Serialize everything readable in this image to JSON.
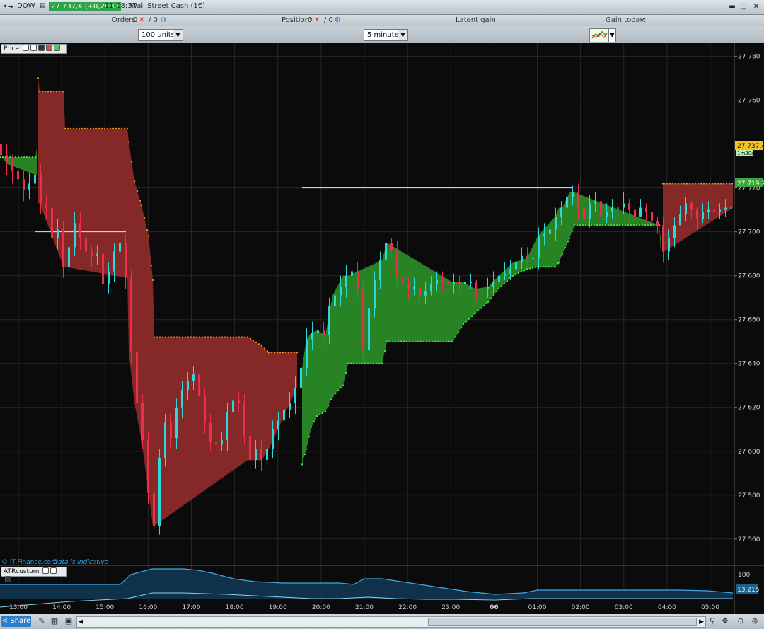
{
  "titlebar": {
    "symbol": "DOW",
    "quote": "27 737,4 (+0,20%)",
    "time": "11:08:37",
    "instrument": "Wall Street Cash (1€)"
  },
  "infobar": {
    "orders_label": "Orders:",
    "orders_value": "0",
    "orders_sep": "/ 0",
    "position_label": "Position:",
    "position_value": "0",
    "position_sep": "/ 0",
    "latent_label": "Latent gain:",
    "latent_value": "-",
    "gain_today_label": "Gain today:",
    "gain_today_value": "-"
  },
  "controls": {
    "units": "100 units",
    "timeframe": "5 minutes"
  },
  "panels": {
    "price_label": "Price",
    "indicator_label": "ATRcustom",
    "watermark": "© IT-Finance.com",
    "watermark_note": "Data is indicative"
  },
  "bottombar": {
    "share": "Share"
  },
  "colors": {
    "bull": "#2fd8d8",
    "bear": "#ea2f4e",
    "fill_up": "#2a8a26",
    "fill_down": "#8c2a2a",
    "stop_up": "#39e83a",
    "stop_down": "#f08a1a",
    "last_price_bg": "#f6c420",
    "trend_price_bg": "#3ba63a"
  },
  "chart_data": {
    "type": "candlestick",
    "price_axis": {
      "ylim": [
        27548,
        27786
      ],
      "ticks": [
        "27 780",
        "27 760",
        "27 740",
        "27 720",
        "27 700",
        "27 680",
        "27 660",
        "27 640",
        "27 620",
        "27 600",
        "27 580",
        "27 560"
      ],
      "tick_values": [
        27780,
        27760,
        27740,
        27720,
        27700,
        27680,
        27660,
        27640,
        27620,
        27600,
        27580,
        27560
      ]
    },
    "time_axis": {
      "labels": [
        "13:00",
        "14:00",
        "15:00",
        "16:00",
        "17:00",
        "18:00",
        "19:00",
        "20:00",
        "21:00",
        "22:00",
        "23:00",
        "06",
        "01:00",
        "02:00",
        "03:00",
        "04:00",
        "05:00"
      ],
      "bold_index": 11
    },
    "last_price": "27 737,4",
    "countdown": "1m20s",
    "trend_level": "27 719,7",
    "indicator_value": "13,215",
    "indicator_axis": {
      "ticks": [
        "100"
      ],
      "tick_values": [
        100
      ]
    },
    "trend_segments": [
      {
        "dir": "up",
        "points": [
          [
            0,
            27734
          ],
          [
            10,
            27734
          ],
          [
            50,
            27734
          ],
          [
            52,
            27738
          ]
        ]
      },
      {
        "dir": "down",
        "points": [
          [
            54,
            27770
          ],
          [
            56,
            27764
          ],
          [
            90,
            27764
          ],
          [
            92,
            27747
          ],
          [
            180,
            27747
          ],
          [
            182,
            27741
          ],
          [
            190,
            27723
          ],
          [
            200,
            27712
          ],
          [
            210,
            27698
          ],
          [
            216,
            27678
          ],
          [
            218,
            27652
          ],
          [
            350,
            27652
          ],
          [
            370,
            27648
          ],
          [
            380,
            27645
          ],
          [
            420,
            27645
          ]
        ]
      },
      {
        "dir": "up",
        "points": [
          [
            427,
            27594
          ],
          [
            433,
            27601
          ],
          [
            440,
            27611
          ],
          [
            448,
            27616
          ],
          [
            460,
            27618
          ],
          [
            470,
            27625
          ],
          [
            485,
            27630
          ],
          [
            492,
            27640
          ],
          [
            540,
            27640
          ],
          [
            547,
            27650
          ],
          [
            640,
            27650
          ],
          [
            655,
            27658
          ],
          [
            672,
            27663
          ],
          [
            690,
            27668
          ],
          [
            705,
            27674
          ],
          [
            725,
            27680
          ],
          [
            745,
            27683
          ],
          [
            760,
            27684
          ],
          [
            785,
            27684
          ],
          [
            790,
            27686
          ],
          [
            795,
            27690
          ],
          [
            805,
            27697
          ],
          [
            812,
            27703
          ],
          [
            932,
            27703
          ],
          [
            934,
            27697
          ]
        ]
      },
      {
        "dir": "down",
        "points": [
          [
            937,
            27722
          ],
          [
            939,
            27722
          ],
          [
            1036,
            27722
          ]
        ]
      }
    ],
    "candles": [
      [
        0,
        27740,
        27735,
        27745,
        27729
      ],
      [
        8,
        27735,
        27731,
        27740,
        27726
      ],
      [
        16,
        27731,
        27728,
        27735,
        27722
      ],
      [
        24,
        27728,
        27724,
        27732,
        27719
      ],
      [
        32,
        27724,
        27719,
        27728,
        27714
      ],
      [
        40,
        27719,
        27722,
        27727,
        27715
      ],
      [
        48,
        27722,
        27726,
        27730,
        27718
      ],
      [
        56,
        27727,
        27713,
        27731,
        27708
      ],
      [
        64,
        27713,
        27711,
        27717,
        27706
      ],
      [
        72,
        27711,
        27697,
        27716,
        27691
      ],
      [
        80,
        27697,
        27701,
        27706,
        27692
      ],
      [
        88,
        27701,
        27684,
        27705,
        27679
      ],
      [
        96,
        27684,
        27693,
        27697,
        27679
      ],
      [
        104,
        27693,
        27704,
        27709,
        27689
      ],
      [
        112,
        27704,
        27697,
        27709,
        27692
      ],
      [
        120,
        27697,
        27691,
        27701,
        27687
      ],
      [
        128,
        27691,
        27689,
        27694,
        27684
      ],
      [
        136,
        27689,
        27690,
        27694,
        27685
      ],
      [
        144,
        27690,
        27676,
        27694,
        27671
      ],
      [
        152,
        27676,
        27682,
        27686,
        27672
      ],
      [
        160,
        27682,
        27691,
        27695,
        27677
      ],
      [
        168,
        27691,
        27695,
        27700,
        27686
      ],
      [
        176,
        27695,
        27679,
        27699,
        27674
      ],
      [
        184,
        27679,
        27645,
        27683,
        27640
      ],
      [
        192,
        27645,
        27622,
        27650,
        27618
      ],
      [
        200,
        27622,
        27605,
        27626,
        27601
      ],
      [
        208,
        27605,
        27581,
        27609,
        27576
      ],
      [
        216,
        27581,
        27566,
        27586,
        27561
      ],
      [
        224,
        27566,
        27597,
        27601,
        27562
      ],
      [
        232,
        27597,
        27613,
        27617,
        27593
      ],
      [
        240,
        27613,
        27606,
        27617,
        27601
      ],
      [
        248,
        27606,
        27620,
        27624,
        27601
      ],
      [
        256,
        27620,
        27628,
        27632,
        27615
      ],
      [
        264,
        27628,
        27632,
        27636,
        27623
      ],
      [
        272,
        27632,
        27635,
        27639,
        27628
      ],
      [
        280,
        27635,
        27625,
        27639,
        27621
      ],
      [
        288,
        27625,
        27613,
        27629,
        27608
      ],
      [
        296,
        27613,
        27604,
        27617,
        27600
      ],
      [
        304,
        27604,
        27603,
        27608,
        27599
      ],
      [
        312,
        27603,
        27605,
        27609,
        27600
      ],
      [
        320,
        27605,
        27618,
        27622,
        27600
      ],
      [
        328,
        27618,
        27623,
        27628,
        27613
      ],
      [
        336,
        27623,
        27622,
        27627,
        27618
      ],
      [
        344,
        27622,
        27607,
        27626,
        27603
      ],
      [
        352,
        27607,
        27596,
        27612,
        27591
      ],
      [
        360,
        27596,
        27601,
        27605,
        27592
      ],
      [
        368,
        27601,
        27596,
        27605,
        27591
      ],
      [
        376,
        27596,
        27601,
        27605,
        27592
      ],
      [
        384,
        27601,
        27610,
        27614,
        27597
      ],
      [
        392,
        27610,
        27614,
        27618,
        27605
      ],
      [
        400,
        27614,
        27619,
        27624,
        27609
      ],
      [
        408,
        27619,
        27622,
        27627,
        27615
      ],
      [
        416,
        27622,
        27629,
        27634,
        27617
      ],
      [
        424,
        27629,
        27638,
        27643,
        27624
      ],
      [
        432,
        27638,
        27651,
        27656,
        27634
      ],
      [
        440,
        27651,
        27654,
        27659,
        27646
      ],
      [
        448,
        27654,
        27655,
        27660,
        27650
      ],
      [
        456,
        27655,
        27653,
        27659,
        27648
      ],
      [
        464,
        27653,
        27666,
        27670,
        27649
      ],
      [
        472,
        27666,
        27671,
        27675,
        27662
      ],
      [
        480,
        27671,
        27675,
        27680,
        27666
      ],
      [
        488,
        27675,
        27680,
        27685,
        27670
      ],
      [
        496,
        27680,
        27682,
        27686,
        27677
      ],
      [
        504,
        27682,
        27674,
        27686,
        27669
      ],
      [
        512,
        27674,
        27646,
        27678,
        27641
      ],
      [
        520,
        27646,
        27665,
        27670,
        27642
      ],
      [
        528,
        27665,
        27678,
        27682,
        27661
      ],
      [
        536,
        27678,
        27687,
        27691,
        27674
      ],
      [
        544,
        27687,
        27695,
        27699,
        27682
      ],
      [
        552,
        27695,
        27692,
        27697,
        27688
      ],
      [
        560,
        27692,
        27679,
        27696,
        27674
      ],
      [
        568,
        27679,
        27676,
        27681,
        27671
      ],
      [
        576,
        27676,
        27674,
        27679,
        27669
      ],
      [
        584,
        27674,
        27675,
        27679,
        27671
      ],
      [
        592,
        27675,
        27671,
        27675,
        27666
      ],
      [
        600,
        27671,
        27673,
        27677,
        27667
      ],
      [
        608,
        27673,
        27676,
        27680,
        27671
      ],
      [
        616,
        27676,
        27678,
        27682,
        27673
      ],
      [
        624,
        27678,
        27677,
        27682,
        27673
      ],
      [
        632,
        27677,
        27676,
        27680,
        27671
      ],
      [
        640,
        27676,
        27677,
        27681,
        27672
      ],
      [
        648,
        27677,
        27676,
        27680,
        27672
      ],
      [
        656,
        27676,
        27677,
        27681,
        27673
      ],
      [
        664,
        27677,
        27677,
        27681,
        27674
      ],
      [
        672,
        27677,
        27674,
        27678,
        27669
      ],
      [
        680,
        27674,
        27674,
        27678,
        27670
      ],
      [
        688,
        27674,
        27675,
        27679,
        27670
      ],
      [
        696,
        27675,
        27677,
        27682,
        27672
      ],
      [
        704,
        27677,
        27680,
        27684,
        27675
      ],
      [
        712,
        27680,
        27681,
        27686,
        27678
      ],
      [
        720,
        27681,
        27683,
        27687,
        27678
      ],
      [
        728,
        27683,
        27686,
        27690,
        27681
      ],
      [
        736,
        27686,
        27689,
        27693,
        27683
      ],
      [
        744,
        27689,
        27688,
        27693,
        27684
      ],
      [
        752,
        27688,
        27688,
        27692,
        27683
      ],
      [
        760,
        27688,
        27698,
        27702,
        27683
      ],
      [
        768,
        27698,
        27699,
        27704,
        27694
      ],
      [
        776,
        27699,
        27701,
        27705,
        27697
      ],
      [
        784,
        27701,
        27707,
        27711,
        27696
      ],
      [
        792,
        27707,
        27711,
        27714,
        27703
      ],
      [
        800,
        27711,
        27716,
        27720,
        27706
      ],
      [
        808,
        27716,
        27718,
        27721,
        27712
      ],
      [
        816,
        27718,
        27711,
        27722,
        27706
      ],
      [
        824,
        27711,
        27706,
        27715,
        27702
      ],
      [
        832,
        27706,
        27713,
        27717,
        27702
      ],
      [
        840,
        27713,
        27714,
        27718,
        27709
      ],
      [
        848,
        27714,
        27707,
        27717,
        27703
      ],
      [
        856,
        27707,
        27709,
        27713,
        27704
      ],
      [
        864,
        27709,
        27711,
        27715,
        27706
      ],
      [
        872,
        27711,
        27711,
        27715,
        27706
      ],
      [
        880,
        27711,
        27713,
        27718,
        27708
      ],
      [
        888,
        27713,
        27710,
        27715,
        27705
      ],
      [
        896,
        27710,
        27707,
        27711,
        27703
      ],
      [
        904,
        27707,
        27711,
        27715,
        27707
      ],
      [
        912,
        27711,
        27709,
        27713,
        27705
      ],
      [
        920,
        27709,
        27705,
        27713,
        27701
      ],
      [
        928,
        27705,
        27703,
        27707,
        27699
      ],
      [
        936,
        27703,
        27691,
        27707,
        27686
      ],
      [
        944,
        27691,
        27697,
        27701,
        27687
      ],
      [
        952,
        27697,
        27703,
        27707,
        27693
      ],
      [
        960,
        27703,
        27708,
        27712,
        27703
      ],
      [
        968,
        27708,
        27713,
        27716,
        27705
      ],
      [
        976,
        27713,
        27710,
        27714,
        27706
      ],
      [
        984,
        27710,
        27706,
        27711,
        27701
      ],
      [
        992,
        27706,
        27709,
        27713,
        27704
      ],
      [
        1000,
        27709,
        27710,
        27714,
        27706
      ],
      [
        1008,
        27710,
        27709,
        27713,
        27705
      ],
      [
        1016,
        27709,
        27710,
        27713,
        27706
      ],
      [
        1024,
        27710,
        27711,
        27715,
        27707
      ],
      [
        1032,
        27711,
        27711,
        27713,
        27708
      ]
    ],
    "reference_lines": [
      {
        "x": [
          50,
          178
        ],
        "y": 27700
      },
      {
        "x": [
          177,
          209
        ],
        "y": 27612
      },
      {
        "x": [
          427,
          810
        ],
        "y": 27720
      },
      {
        "x": [
          810,
          937
        ],
        "y": 27761
      },
      {
        "x": [
          937,
          1036
        ],
        "y": 27652
      }
    ],
    "atr": {
      "upper": [
        [
          0,
          826
        ],
        [
          60,
          826
        ],
        [
          120,
          826
        ],
        [
          170,
          826
        ],
        [
          185,
          812
        ],
        [
          215,
          804
        ],
        [
          260,
          804
        ],
        [
          280,
          806
        ],
        [
          300,
          810
        ],
        [
          330,
          818
        ],
        [
          360,
          822
        ],
        [
          400,
          824
        ],
        [
          440,
          824
        ],
        [
          480,
          824
        ],
        [
          500,
          826
        ],
        [
          515,
          818
        ],
        [
          540,
          818
        ],
        [
          580,
          824
        ],
        [
          620,
          830
        ],
        [
          660,
          836
        ],
        [
          700,
          840
        ],
        [
          740,
          838
        ],
        [
          760,
          834
        ],
        [
          800,
          834
        ],
        [
          840,
          834
        ],
        [
          880,
          834
        ],
        [
          920,
          834
        ],
        [
          960,
          834
        ],
        [
          1000,
          835
        ],
        [
          1036,
          838
        ]
      ],
      "lower": [
        [
          0,
          858
        ],
        [
          100,
          850
        ],
        [
          180,
          846
        ],
        [
          215,
          838
        ],
        [
          260,
          838
        ],
        [
          320,
          840
        ],
        [
          400,
          844
        ],
        [
          440,
          846
        ],
        [
          480,
          846
        ],
        [
          520,
          844
        ],
        [
          560,
          846
        ],
        [
          600,
          847
        ],
        [
          640,
          847
        ],
        [
          700,
          848
        ],
        [
          750,
          846
        ],
        [
          800,
          846
        ],
        [
          880,
          846
        ],
        [
          960,
          846
        ],
        [
          1000,
          846
        ],
        [
          1036,
          846
        ]
      ]
    }
  }
}
